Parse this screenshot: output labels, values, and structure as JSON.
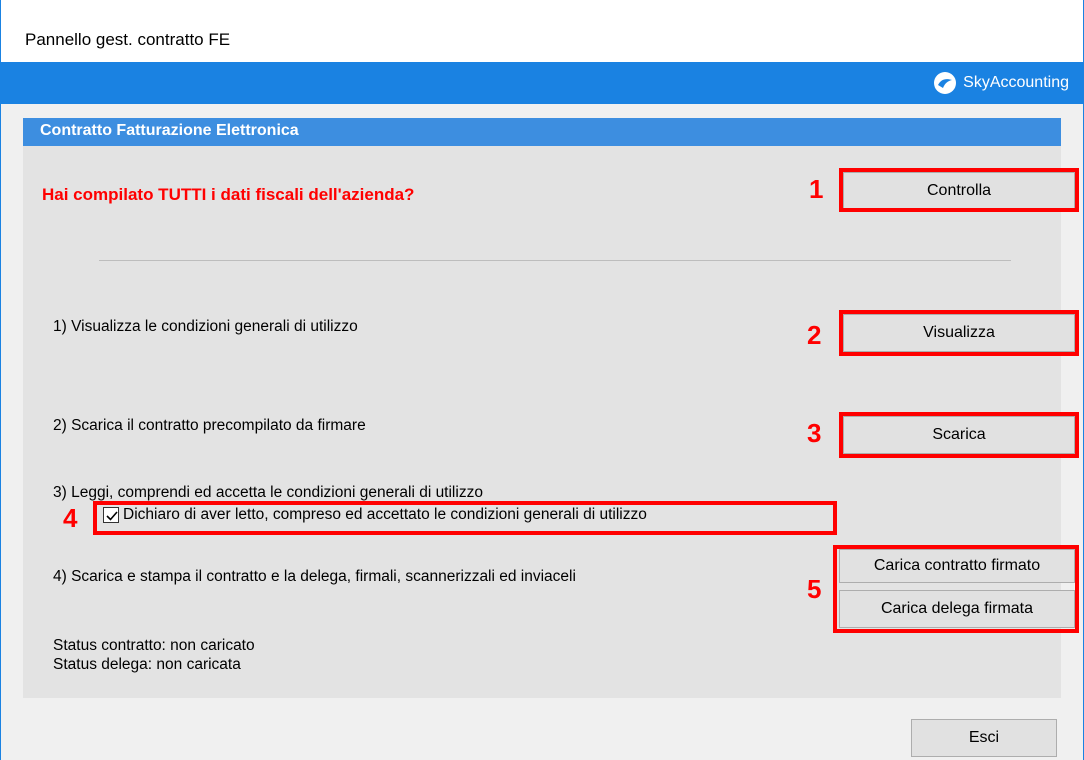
{
  "window": {
    "title": "Pannello gest. contratto FE",
    "brand": "SkyAccounting"
  },
  "panel": {
    "title": "Contratto Fatturazione Elettronica",
    "question": "Hai compilato TUTTI i dati fiscali dell'azienda?",
    "steps": [
      "1) Visualizza le condizioni generali di utilizzo",
      "2) Scarica il contratto precompilato da firmare",
      "3) Leggi, comprendi ed accetta le condizioni generali di utilizzo",
      "4) Scarica e stampa il contratto e la delega, firmali, scannerizzali ed inviaceli"
    ],
    "checkbox": {
      "label": "Dichiaro di aver letto, compreso ed accettato le condizioni generali di utilizzo",
      "checked": true
    },
    "status_contract": "Status contratto: non caricato",
    "status_delegation": "Status delega: non caricata"
  },
  "buttons": {
    "controlla": "Controlla",
    "visualizza": "Visualizza",
    "scarica": "Scarica",
    "carica_contratto": "Carica contratto firmato",
    "carica_delega": "Carica delega firmata",
    "esci": "Esci"
  },
  "annotations": {
    "n1": "1",
    "n2": "2",
    "n3": "3",
    "n4": "4",
    "n5": "5",
    "color": "#ff0000"
  },
  "colors": {
    "accent": "#1a82e2",
    "panel_header": "#3d8ee0",
    "warning_text": "#ff0000"
  }
}
